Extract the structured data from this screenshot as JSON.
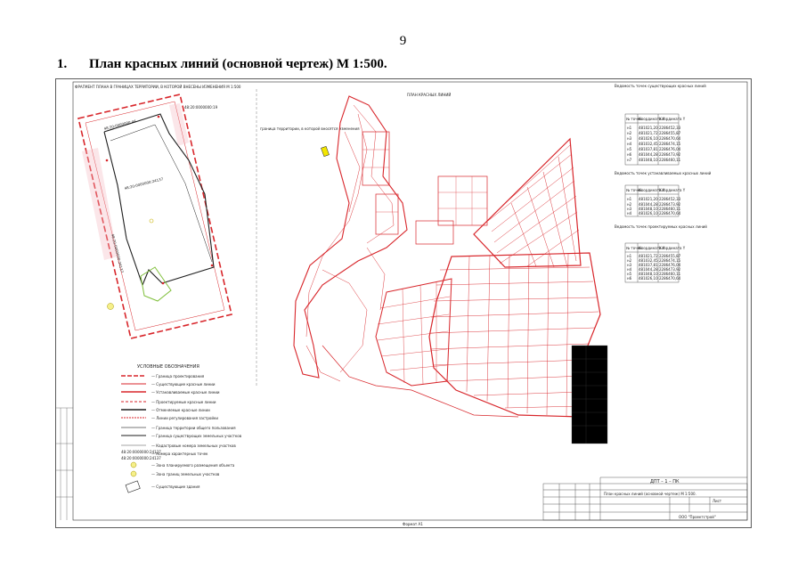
{
  "page": {
    "page_number": "9",
    "section_number": "1.",
    "section_title": "План красных линий (основной чертеж) М 1:500."
  },
  "drawing": {
    "fragment_title": "ФРАГМЕНТ ПЛАНА В ГРАНИЦАХ ТЕРРИТОРИИ, В КОТОРОЙ ВНЕСЕНЫ ИЗМЕНЕНИЯ М 1:500",
    "main_plan_title": "ПЛАН КРАСНЫХ ЛИНИЙ",
    "locator_note": "граница территории, в которой вносятся изменения",
    "legend_title": "УСЛОВНЫЕ ОБОЗНАЧЕНИЯ",
    "legend_items": [
      "— Граница проектирования",
      "— Существующие красные линии",
      "— Устанавливаемые красные линии",
      "— Проектируемые красные линии",
      "— Отменяемые красные линии",
      "— Линии регулирования застройки",
      "— Граница территории общего пользования",
      "— Граница существующих земельных участков",
      "— Кадастровые номера земельных участков",
      "— Номера характерных точек",
      "— Зона планируемого размещения объекта",
      "— Зона границ земельных участков",
      "— Существующие здания"
    ],
    "stamp_code": "ДПТ – 1 – ПК",
    "stamp_company": "ООО \"Проектстрой\"",
    "stamp_sheet_label": "Лист",
    "bottom_note": "Формат А1"
  },
  "coordinate_tables": [
    {
      "caption": "Ведомость точек существующих красных линий",
      "headers": [
        "№ точки",
        "Координата X",
        "Координата Y"
      ],
      "rows": [
        [
          "н1",
          "481021,20",
          "2286452,33"
        ],
        [
          "н2",
          "481021,72",
          "2286455,87"
        ],
        [
          "н3",
          "481026,10",
          "2286470,64"
        ],
        [
          "н4",
          "481032,45",
          "2286474,15"
        ],
        [
          "н5",
          "481037,81",
          "2286476,04"
        ],
        [
          "н6",
          "481044,28",
          "2286473,92"
        ],
        [
          "н7",
          "481048,10",
          "2286460,11"
        ]
      ]
    },
    {
      "caption": "Ведомость точек устанавливаемых красных линий",
      "headers": [
        "№ точки",
        "Координата X",
        "Координата Y"
      ],
      "rows": [
        [
          "н1",
          "481021,20",
          "2286452,33"
        ],
        [
          "н2",
          "481044,28",
          "2286473,92"
        ],
        [
          "н3",
          "481048,10",
          "2286460,11"
        ],
        [
          "н4",
          "481026,10",
          "2286470,64"
        ]
      ]
    },
    {
      "caption": "Ведомость точек проектируемых красных линий",
      "headers": [
        "№ точки",
        "Координата X",
        "Координата Y"
      ],
      "rows": [
        [
          "н1",
          "481021,72",
          "2286455,87"
        ],
        [
          "н2",
          "481032,45",
          "2286474,15"
        ],
        [
          "н3",
          "481037,81",
          "2286476,04"
        ],
        [
          "н4",
          "481044,28",
          "2286473,92"
        ],
        [
          "н5",
          "481048,10",
          "2286460,11"
        ],
        [
          "н6",
          "481026,10",
          "2286470,64"
        ]
      ]
    }
  ],
  "colors": {
    "red_line": "#d8262b",
    "dark_line": "#1e1e1e",
    "highlight": "#f3e600",
    "green_line": "#7fbf3a",
    "paper": "#ffffff"
  }
}
